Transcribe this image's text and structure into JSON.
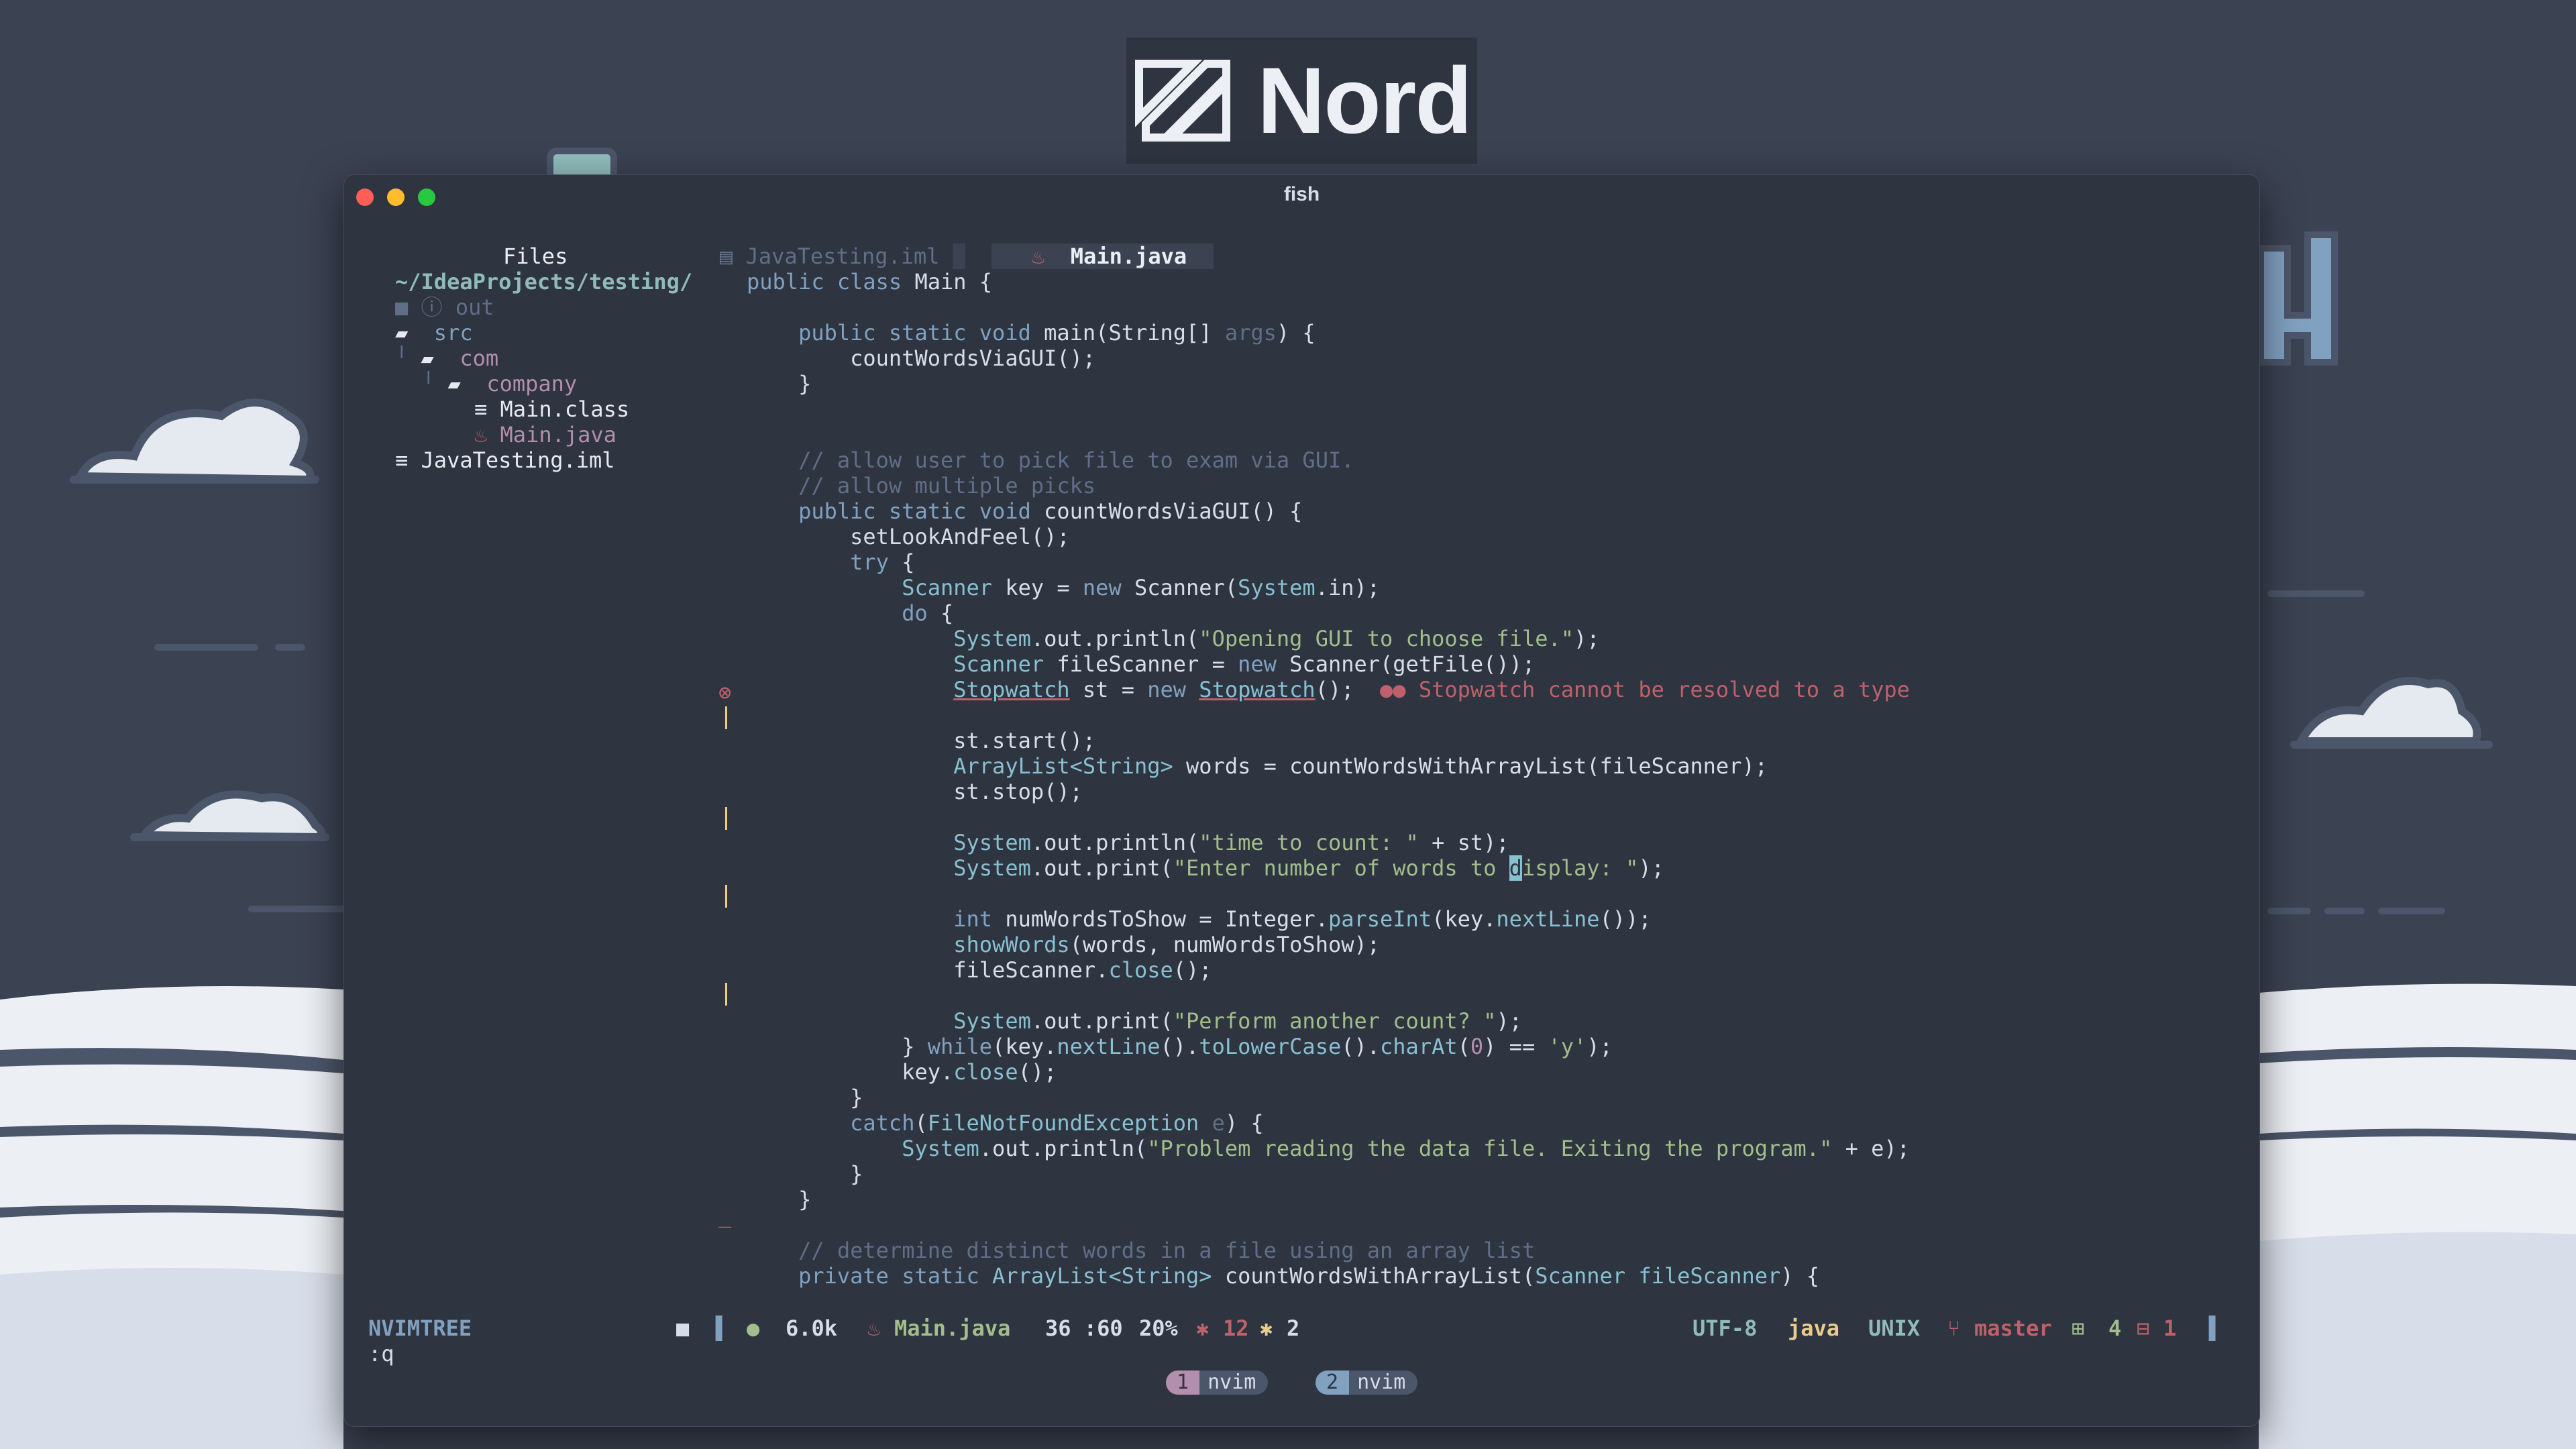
{
  "brand": {
    "name": "Nord"
  },
  "window": {
    "title": "fish"
  },
  "sidebar": {
    "title": "Files",
    "root": "~/IdeaProjects/testing/",
    "items": [
      "out",
      "src",
      "com",
      "company",
      "Main.class",
      "Main.java",
      "JavaTesting.iml"
    ]
  },
  "tabs": [
    {
      "label": "JavaTesting.iml",
      "active": false
    },
    {
      "label": "Main.java",
      "active": true
    }
  ],
  "code": {
    "lines": [
      "public class Main {",
      "",
      "    public static void main(String[] args) {",
      "        countWordsViaGUI();",
      "    }",
      "",
      "",
      "    // allow user to pick file to exam via GUI.",
      "    // allow multiple picks",
      "    public static void countWordsViaGUI() {",
      "        setLookAndFeel();",
      "        try {",
      "            Scanner key = new Scanner(System.in);",
      "            do {",
      "                System.out.println(\"Opening GUI to choose file.\");",
      "                Scanner fileScanner = new Scanner(getFile());",
      "                Stopwatch st = new Stopwatch();",
      "",
      "                st.start();",
      "                ArrayList<String> words = countWordsWithArrayList(fileScanner);",
      "                st.stop();",
      "",
      "                System.out.println(\"time to count: \" + st);",
      "                System.out.print(\"Enter number of words to display: \");",
      "",
      "                int numWordsToShow = Integer.parseInt(key.nextLine());",
      "                showWords(words, numWordsToShow);",
      "                fileScanner.close();",
      "",
      "                System.out.print(\"Perform another count? \");",
      "            } while(key.nextLine().toLowerCase().charAt(0) == 'y');",
      "            key.close();",
      "        }",
      "        catch(FileNotFoundException e) {",
      "            System.out.println(\"Problem reading the data file. Exiting the program.\" + e);",
      "        }",
      "    }",
      "",
      "    // determine distinct words in a file using an array list",
      "    private static ArrayList<String> countWordsWithArrayList(Scanner fileScanner) {"
    ],
    "diagnostic": "Stopwatch cannot be resolved to a type"
  },
  "statusline": {
    "mode": "NVIMTREE",
    "size": "6.0k",
    "file": "Main.java",
    "position": "36 :60",
    "percent": "20%",
    "errors": "12",
    "warnings": "2",
    "encoding": "UTF-8",
    "filetype": "java",
    "format": "UNIX",
    "branch": "master",
    "added": "4",
    "removed": "1"
  },
  "cmdline": ":q",
  "tmux": [
    {
      "num": "1",
      "label": "nvim"
    },
    {
      "num": "2",
      "label": "nvim"
    }
  ],
  "colors": {
    "background": "#2e3440",
    "accent": "#88c0d0",
    "error": "#bf616a",
    "warning": "#ebcb8b",
    "string": "#a3be8c"
  }
}
